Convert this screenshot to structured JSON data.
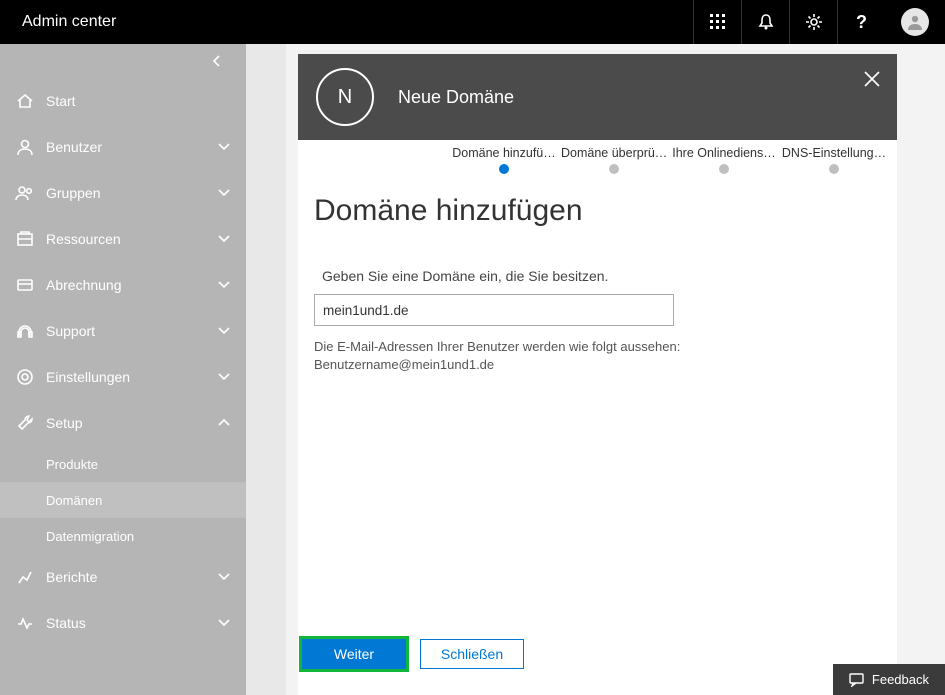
{
  "topbar": {
    "title": "Admin center"
  },
  "sidebar": {
    "items": [
      {
        "label": "Start",
        "icon": "home",
        "expandable": false
      },
      {
        "label": "Benutzer",
        "icon": "user",
        "expandable": true
      },
      {
        "label": "Gruppen",
        "icon": "groups",
        "expandable": true
      },
      {
        "label": "Ressourcen",
        "icon": "resources",
        "expandable": true
      },
      {
        "label": "Abrechnung",
        "icon": "billing",
        "expandable": true
      },
      {
        "label": "Support",
        "icon": "support",
        "expandable": true
      },
      {
        "label": "Einstellungen",
        "icon": "settings",
        "expandable": true
      },
      {
        "label": "Setup",
        "icon": "setup",
        "expandable": true,
        "expanded": true,
        "children": [
          {
            "label": "Produkte"
          },
          {
            "label": "Domänen",
            "active": true
          },
          {
            "label": "Datenmigration"
          }
        ]
      },
      {
        "label": "Berichte",
        "icon": "reports",
        "expandable": true
      },
      {
        "label": "Status",
        "icon": "status",
        "expandable": true
      }
    ]
  },
  "panel": {
    "letter": "N",
    "title": "Neue Domäne",
    "steps": [
      {
        "label": "Domäne hinzufü…",
        "active": true
      },
      {
        "label": "Domäne überprü…"
      },
      {
        "label": "Ihre Onlinediens…"
      },
      {
        "label": "DNS-Einstellung…"
      }
    ],
    "heading": "Domäne hinzufügen",
    "prompt": "Geben Sie eine Domäne ein, die Sie besitzen.",
    "domain_value": "mein1und1.de",
    "hint_line1": "Die E-Mail-Adressen Ihrer Benutzer werden wie folgt aussehen:",
    "hint_line2": "Benutzername@mein1und1.de",
    "next_label": "Weiter",
    "close_label": "Schließen"
  },
  "feedback": {
    "label": "Feedback"
  }
}
